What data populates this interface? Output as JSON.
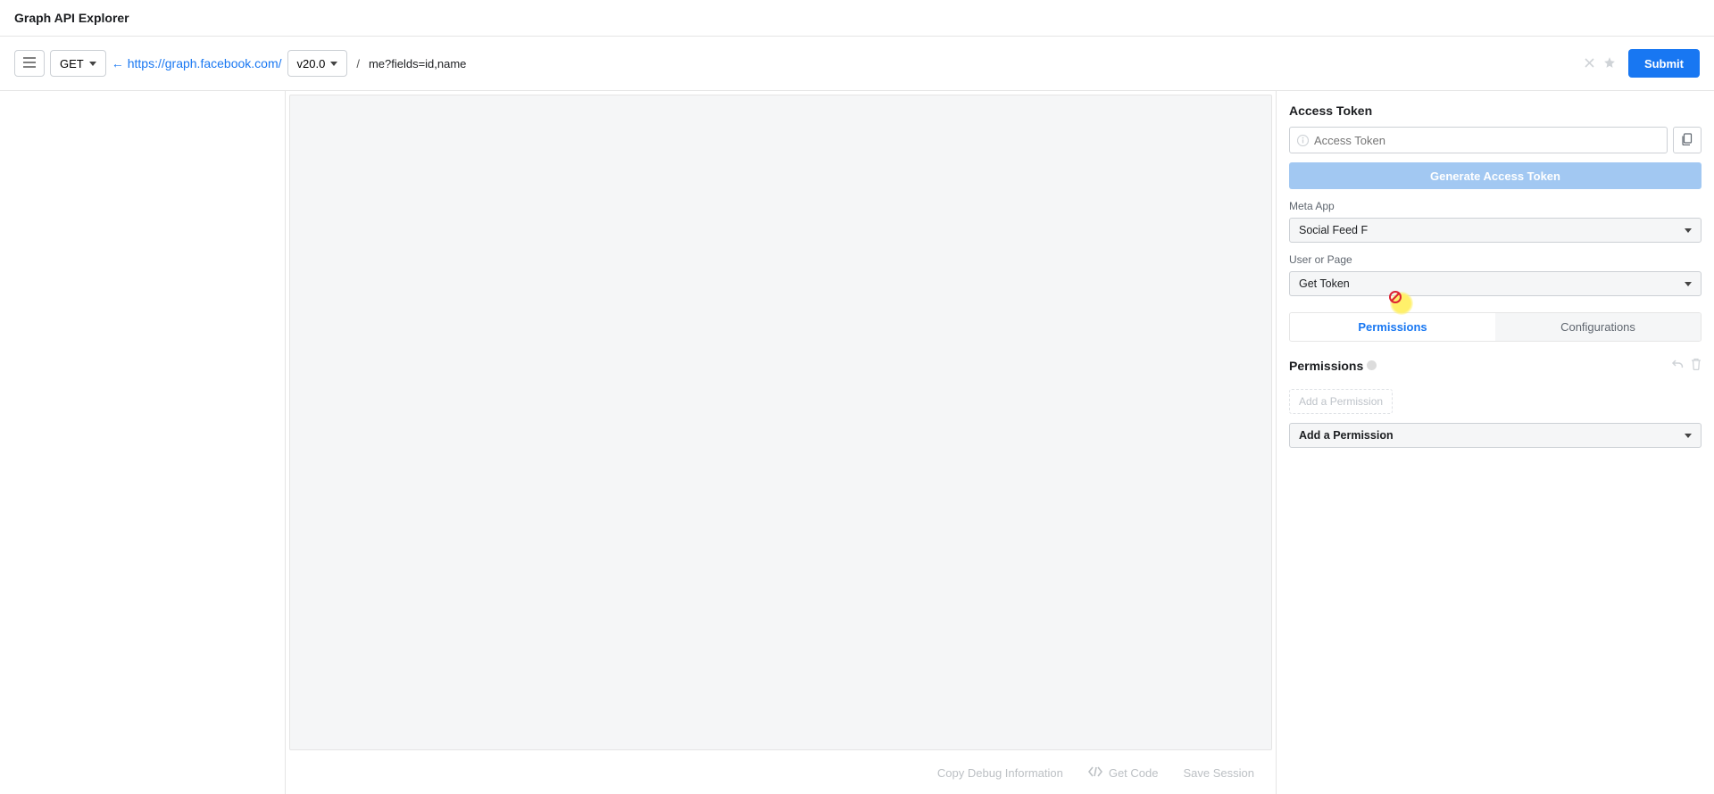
{
  "header": {
    "title": "Graph API Explorer"
  },
  "toolbar": {
    "method": "GET",
    "base_url": "https://graph.facebook.com/",
    "version": "v20.0",
    "query": "me?fields=id,name",
    "submit": "Submit"
  },
  "midActions": {
    "copy_debug": "Copy Debug Information",
    "get_code": "Get Code",
    "save_session": "Save Session"
  },
  "right": {
    "access_token_title": "Access Token",
    "access_token_placeholder": "Access Token",
    "generate_label": "Generate Access Token",
    "meta_app_label": "Meta App",
    "meta_app_value": "Social Feed F",
    "user_or_page_label": "User or Page",
    "user_or_page_value": "Get Token",
    "tabs": {
      "permissions": "Permissions",
      "configurations": "Configurations"
    },
    "permissions_title": "Permissions",
    "add_permission_chip": "Add a Permission",
    "add_permission_dropdown": "Add a Permission"
  }
}
